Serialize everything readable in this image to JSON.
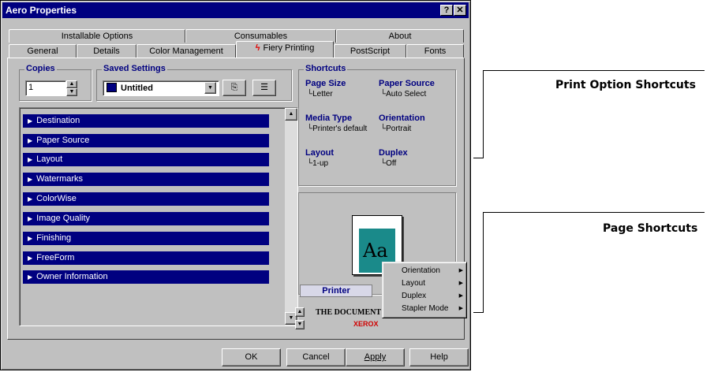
{
  "window": {
    "title": "Aero Properties",
    "help_button": "?",
    "close_button": "✕"
  },
  "tabs_back": [
    "Installable Options",
    "Consumables",
    "About"
  ],
  "tabs_front": [
    "General",
    "Details",
    "Color Management",
    "Fiery Printing",
    "PostScript",
    "Fonts"
  ],
  "copies": {
    "label": "Copies",
    "value": "1"
  },
  "saved_settings": {
    "label": "Saved Settings",
    "value": "Untitled"
  },
  "options": [
    "Destination",
    "Paper Source",
    "Layout",
    "Watermarks",
    "ColorWise",
    "Image Quality",
    "Finishing",
    "FreeForm",
    "Owner Information"
  ],
  "shortcuts": {
    "title": "Shortcuts",
    "page_size": {
      "label": "Page Size",
      "value": "Letter"
    },
    "paper_source": {
      "label": "Paper Source",
      "value": "Auto Select"
    },
    "media_type": {
      "label": "Media Type",
      "value": "Printer's default"
    },
    "orientation": {
      "label": "Orientation",
      "value": "Portrait"
    },
    "layout": {
      "label": "Layout",
      "value": "1-up"
    },
    "duplex": {
      "label": "Duplex",
      "value": "Off"
    }
  },
  "preview": {
    "sample_text": "Aa",
    "printer_tab": "Printer",
    "doc_company": "THE DOCUMENT C",
    "brand": "XEROX"
  },
  "context_menu": [
    "Orientation",
    "Layout",
    "Duplex",
    "Stapler Mode"
  ],
  "buttons": {
    "ok": "OK",
    "cancel": "Cancel",
    "apply": "Apply",
    "help": "Help"
  },
  "annotations": {
    "print_option_shortcuts": "Print Option Shortcuts",
    "page_shortcuts": "Page Shortcuts"
  },
  "colors": {
    "title_bar": "#000080",
    "option_bar": "#000080",
    "preview_page": "#1a8a8a",
    "brand_red": "#d00000"
  }
}
